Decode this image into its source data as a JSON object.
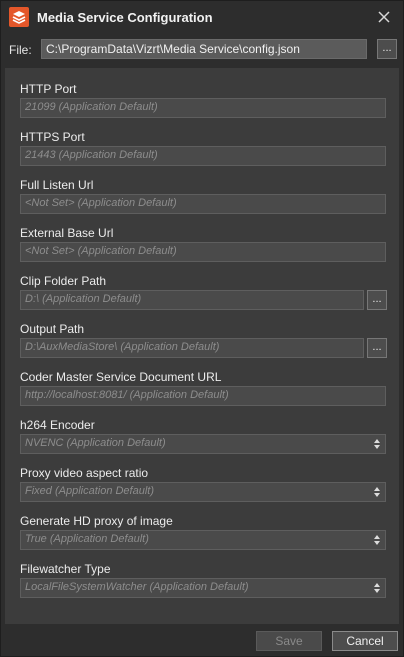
{
  "window": {
    "title": "Media Service Configuration"
  },
  "file": {
    "label": "File:",
    "value": "C:\\ProgramData\\Vizrt\\Media Service\\config.json",
    "browse_label": "..."
  },
  "fields": {
    "http_port": {
      "label": "HTTP Port",
      "placeholder": "21099 (Application Default)"
    },
    "https_port": {
      "label": "HTTPS Port",
      "placeholder": "21443 (Application Default)"
    },
    "full_listen_url": {
      "label": "Full Listen Url",
      "placeholder": "<Not Set> (Application Default)"
    },
    "external_base_url": {
      "label": "External Base Url",
      "placeholder": "<Not Set> (Application Default)"
    },
    "clip_folder_path": {
      "label": "Clip Folder Path",
      "placeholder": "D:\\ (Application Default)",
      "browse_label": "..."
    },
    "output_path": {
      "label": "Output Path",
      "placeholder": "D:\\AuxMediaStore\\ (Application Default)",
      "browse_label": "..."
    },
    "coder_master_url": {
      "label": "Coder Master Service Document URL",
      "placeholder": "http://localhost:8081/ (Application Default)"
    },
    "h264_encoder": {
      "label": "h264 Encoder",
      "selected": "NVENC (Application Default)"
    },
    "proxy_aspect": {
      "label": "Proxy video aspect ratio",
      "selected": "Fixed (Application Default)"
    },
    "hd_proxy": {
      "label": "Generate HD proxy of image",
      "selected": "True (Application Default)"
    },
    "filewatcher_type": {
      "label": "Filewatcher Type",
      "selected": "LocalFileSystemWatcher (Application Default)"
    }
  },
  "footer": {
    "save_label": "Save",
    "cancel_label": "Cancel"
  },
  "colors": {
    "accent": "#e4572a",
    "background": "#2d2d2d",
    "panel": "#3c3c3c"
  }
}
